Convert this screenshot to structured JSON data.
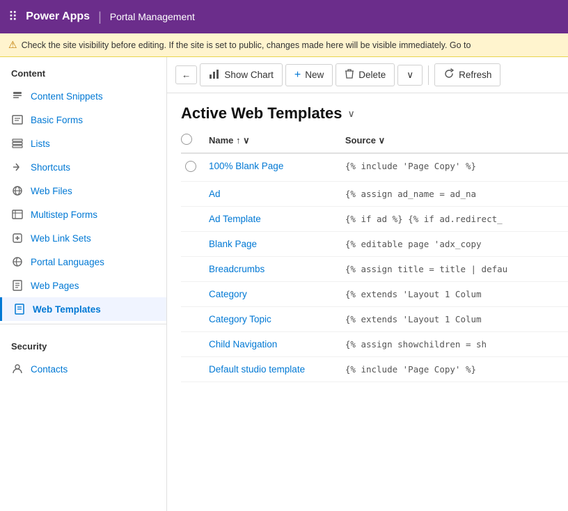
{
  "app": {
    "grid_icon": "⊞",
    "name": "Power Apps",
    "divider": "|",
    "portal": "Portal Management"
  },
  "warning": {
    "icon": "⚠",
    "text": "Check the site visibility before editing. If the site is set to public, changes made here will be visible immediately. Go to"
  },
  "toolbar": {
    "back_icon": "←",
    "show_chart_icon": "📊",
    "show_chart_label": "Show Chart",
    "new_icon": "+",
    "new_label": "New",
    "delete_icon": "🗑",
    "delete_label": "Delete",
    "more_icon": "∨",
    "refresh_icon": "↻",
    "refresh_label": "Refresh"
  },
  "page": {
    "title": "Active Web Templates",
    "dropdown_icon": "∨"
  },
  "table": {
    "columns": [
      {
        "key": "name",
        "label": "Name",
        "sort_icon": "↑ ∨"
      },
      {
        "key": "source",
        "label": "Source",
        "sort_icon": "∨"
      }
    ],
    "rows": [
      {
        "name": "100% Blank Page",
        "source": "{% include 'Page Copy' %}"
      },
      {
        "name": "Ad",
        "source": "{% assign ad_name = ad_na"
      },
      {
        "name": "Ad Template",
        "source": "{% if ad %} {% if ad.redirect_"
      },
      {
        "name": "Blank Page",
        "source": "{% editable page 'adx_copy"
      },
      {
        "name": "Breadcrumbs",
        "source": "{% assign title = title | defau"
      },
      {
        "name": "Category",
        "source": "{% extends 'Layout 1 Colum"
      },
      {
        "name": "Category Topic",
        "source": "{% extends 'Layout 1 Colum"
      },
      {
        "name": "Child Navigation",
        "source": "{% assign showchildren = sh"
      },
      {
        "name": "Default studio template",
        "source": "{% include 'Page Copy' %}"
      }
    ]
  },
  "sidebar": {
    "content_section": "Content",
    "items": [
      {
        "id": "content-snippets",
        "label": "Content Snippets",
        "icon": "📄"
      },
      {
        "id": "basic-forms",
        "label": "Basic Forms",
        "icon": "📋"
      },
      {
        "id": "lists",
        "label": "Lists",
        "icon": "📑"
      },
      {
        "id": "shortcuts",
        "label": "Shortcuts",
        "icon": "🔗"
      },
      {
        "id": "web-files",
        "label": "Web Files",
        "icon": "🌐"
      },
      {
        "id": "multistep-forms",
        "label": "Multistep Forms",
        "icon": "📝"
      },
      {
        "id": "web-link-sets",
        "label": "Web Link Sets",
        "icon": "🔗"
      },
      {
        "id": "portal-languages",
        "label": "Portal Languages",
        "icon": "🌍"
      },
      {
        "id": "web-pages",
        "label": "Web Pages",
        "icon": "📄"
      },
      {
        "id": "web-templates",
        "label": "Web Templates",
        "icon": "📄",
        "active": true
      }
    ],
    "security_section": "Security",
    "security_items": [
      {
        "id": "contacts",
        "label": "Contacts",
        "icon": "👤"
      }
    ]
  }
}
